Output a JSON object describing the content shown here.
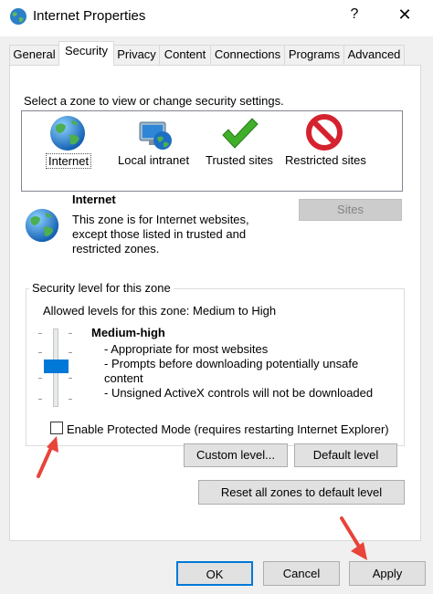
{
  "window": {
    "title": "Internet Properties",
    "help_glyph": "?",
    "close_glyph": "✕"
  },
  "tabs": [
    {
      "label": "General",
      "active": false
    },
    {
      "label": "Security",
      "active": true
    },
    {
      "label": "Privacy",
      "active": false
    },
    {
      "label": "Content",
      "active": false
    },
    {
      "label": "Connections",
      "active": false
    },
    {
      "label": "Programs",
      "active": false
    },
    {
      "label": "Advanced",
      "active": false
    }
  ],
  "security": {
    "zone_prompt": "Select a zone to view or change security settings.",
    "zones": [
      {
        "label": "Internet",
        "icon": "globe-icon",
        "selected": true
      },
      {
        "label": "Local intranet",
        "icon": "intranet-icon",
        "selected": false
      },
      {
        "label": "Trusted sites",
        "icon": "checkmark-icon",
        "selected": false
      },
      {
        "label": "Restricted sites",
        "icon": "restricted-icon",
        "selected": false
      }
    ],
    "selected_zone": {
      "name": "Internet",
      "desc_line1": "This zone is for Internet websites,",
      "desc_line2": "except those listed in trusted and",
      "desc_line3": "restricted zones."
    },
    "sites_button": "Sites",
    "level_group_title": "Security level for this zone",
    "allowed_levels": "Allowed levels for this zone: Medium to High",
    "level_name": "Medium-high",
    "level_bullets": [
      "- Appropriate for most websites",
      "- Prompts before downloading potentially unsafe",
      "content",
      "- Unsigned ActiveX controls will not be downloaded"
    ],
    "protected_mode_label": "Enable Protected Mode (requires restarting Internet Explorer)",
    "protected_mode_checked": false,
    "custom_level_button": "Custom level...",
    "default_level_button": "Default level",
    "reset_all_button": "Reset all zones to default level"
  },
  "footer": {
    "ok": "OK",
    "cancel": "Cancel",
    "apply": "Apply"
  },
  "colors": {
    "accent": "#0078d7",
    "annotation_arrow": "#e8443a",
    "check_green": "#3fae29",
    "restricted_red": "#d5222f"
  }
}
